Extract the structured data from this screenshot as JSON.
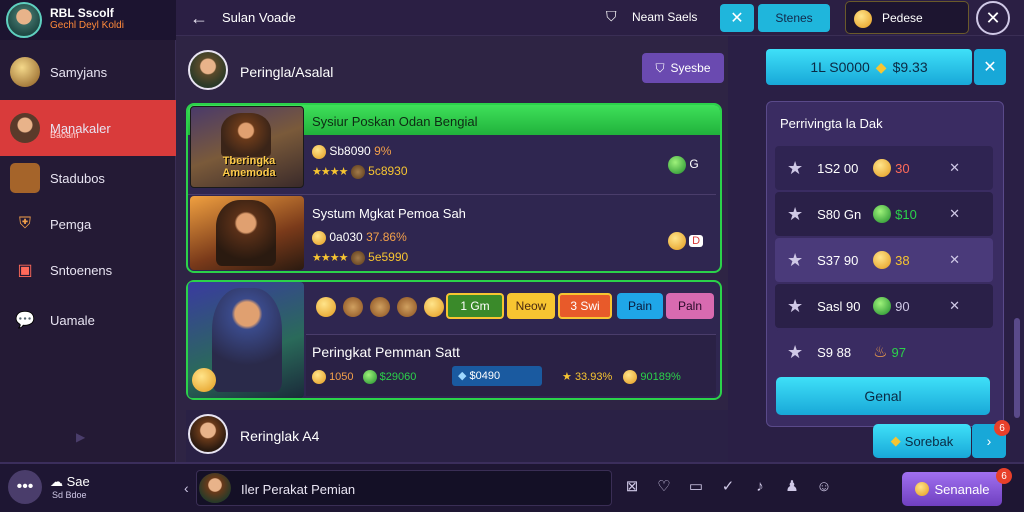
{
  "brand": {
    "title": "RBL Sscolf",
    "subtitle": "Gechl Deyl Koldi"
  },
  "sidebar": {
    "items": [
      {
        "label": "Samyjans",
        "icon": "coin-icon"
      },
      {
        "label": "Manakaler",
        "sub": "Baoam",
        "icon": "avatar-icon",
        "active": true
      },
      {
        "label": "Stadubos",
        "icon": "chest-icon"
      },
      {
        "label": "Pemga",
        "icon": "shield-icon"
      },
      {
        "label": "Sntoenens",
        "icon": "tv-icon"
      },
      {
        "label": "Uamale",
        "icon": "chat-icon"
      }
    ]
  },
  "topbar": {
    "title": "Sulan Voade",
    "user_label": "Neam Saels",
    "button1": "Stenes",
    "wallet": "Pedese"
  },
  "main": {
    "header_title": "Peringla/Asalal",
    "header_button": "Syesbe",
    "cards": [
      {
        "title": "Sysiur Poskan Odan Bengial",
        "thumb_text": "Tberingka Amemoda",
        "coins": "Sb8090",
        "coins_pct": "9%",
        "score": "5c8930",
        "badge": "G"
      },
      {
        "title": "Systum Mgkat Pemoa Sah",
        "coins": "0a030",
        "coins_pct": "37.86%",
        "score": "5e5990",
        "badge": "D"
      },
      {
        "title": "Peringkat Pemman Satt",
        "tags": [
          "1 Gm",
          "Neow",
          "3 Swi",
          "Pain",
          "Paln"
        ],
        "stat1": "1050",
        "stat2": "$29060",
        "stat3": "$0490",
        "stat4": "33.93%",
        "stat5": "90189%"
      }
    ],
    "footer_title": "Reringlak A4"
  },
  "right": {
    "top_button": "1L S0000",
    "top_button_amount": "$9.33",
    "panel_title": "Perrivingta la Dak",
    "rows": [
      {
        "value": "1S2 00",
        "amount": "30",
        "kind": "coin"
      },
      {
        "value": "S80 Gn",
        "amount": "$10",
        "kind": "gem"
      },
      {
        "value": "S37 90",
        "amount": "38",
        "kind": "coin"
      },
      {
        "value": "Sasl 90",
        "amount": "90",
        "kind": "gem"
      },
      {
        "value": "S9 88",
        "amount": "97",
        "kind": "flame"
      }
    ],
    "panel_button": "Genal",
    "bottom_button": "Sorebak",
    "notif1": "6",
    "notif2": "6"
  },
  "bottom": {
    "left_label": "Sae",
    "left_sub": "Sd Bdoe",
    "chat_placeholder": "Iler Perakat Pemian",
    "right_button": "Senanale"
  },
  "colors": {
    "accent": "#22c7e8",
    "active": "#d93b3b",
    "green": "#2bd24a",
    "purple": "#8b5fd6"
  }
}
